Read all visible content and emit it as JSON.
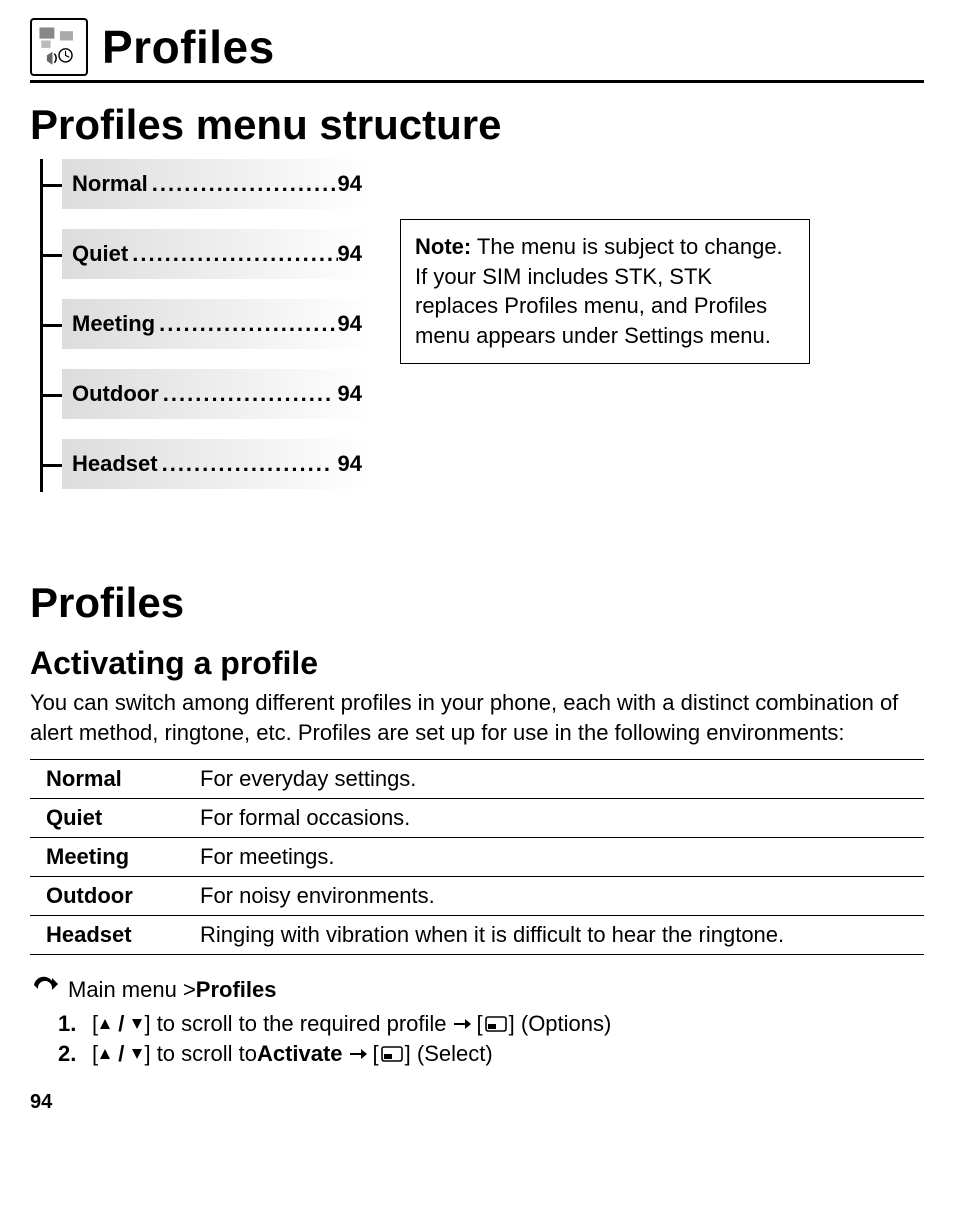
{
  "chapter": {
    "title": "Profiles"
  },
  "section1": {
    "title": "Profiles menu structure"
  },
  "menu": {
    "items": [
      {
        "label": "Normal",
        "page": "94"
      },
      {
        "label": "Quiet",
        "page": "94"
      },
      {
        "label": "Meeting",
        "page": "94"
      },
      {
        "label": "Outdoor",
        "page": "94"
      },
      {
        "label": "Headset",
        "page": "94"
      }
    ]
  },
  "note": {
    "label": "Note:",
    "text": " The menu is subject to change. If your SIM includes STK, STK replaces Profiles menu, and Profiles menu appears under Settings menu."
  },
  "section2": {
    "title": "Profiles"
  },
  "section3": {
    "title": "Activating a profile"
  },
  "intro": "You can switch among different profiles in your phone, each with a distinct combination of alert method, ringtone, etc. Profiles are set up for use in the following environments:",
  "table": {
    "rows": [
      {
        "name": "Normal",
        "desc": "For everyday settings."
      },
      {
        "name": "Quiet",
        "desc": "For formal occasions."
      },
      {
        "name": "Meeting",
        "desc": "For meetings."
      },
      {
        "name": "Outdoor",
        "desc": "For noisy environments."
      },
      {
        "name": "Headset",
        "desc": "Ringing with vibration when it is difficult to hear the ringtone."
      }
    ]
  },
  "nav": {
    "prefix": "Main menu > ",
    "target": "Profiles"
  },
  "steps": {
    "s1_num": "1.",
    "s1_a": "[",
    "s1_b": "] to scroll to the required profile ",
    "s1_c": " [",
    "s1_d": "] (Options)",
    "s2_num": "2.",
    "s2_a": "[",
    "s2_b": "] to scroll to ",
    "s2_bold": "Activate",
    "s2_c": " ",
    "s2_d": " [",
    "s2_e": "] (Select)"
  },
  "page_number": "94"
}
